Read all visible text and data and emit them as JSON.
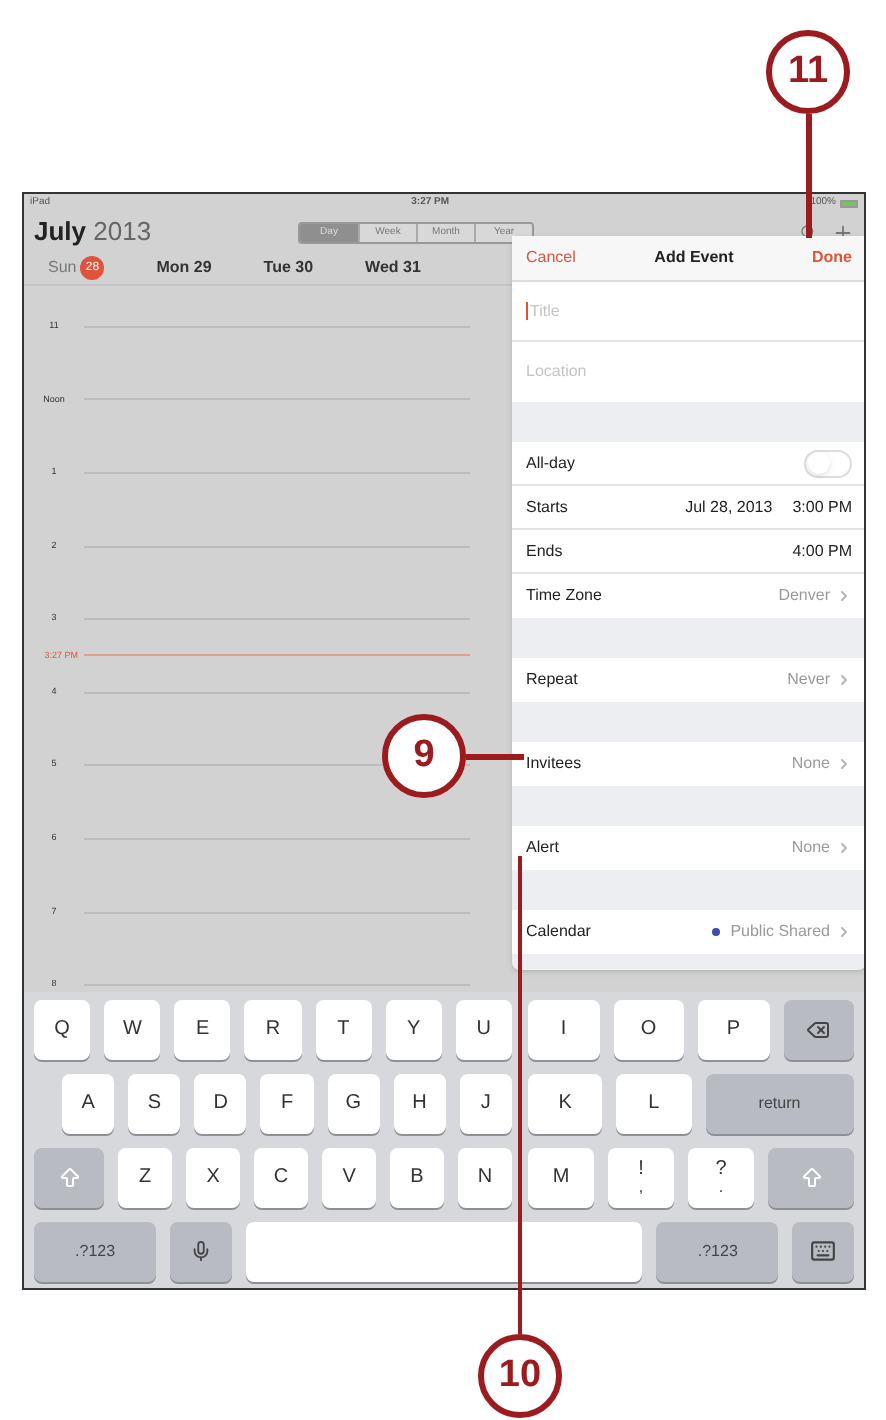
{
  "status_bar": {
    "carrier": "iPad",
    "time": "3:27 PM",
    "battery": "100%"
  },
  "header": {
    "month": "July",
    "year": "2013"
  },
  "view_tabs": [
    {
      "label": "Day",
      "selected": true
    },
    {
      "label": "Week",
      "selected": false
    },
    {
      "label": "Month",
      "selected": false
    },
    {
      "label": "Year",
      "selected": false
    }
  ],
  "days": [
    {
      "label": "Sun",
      "badge": "28",
      "today": true
    },
    {
      "label": "Mon 29",
      "today": false
    },
    {
      "label": "Tue 30",
      "today": false
    },
    {
      "label": "Wed 31",
      "today": false
    }
  ],
  "timeline": [
    {
      "kind": "hour",
      "label": "11"
    },
    {
      "kind": "hour",
      "label": "Noon"
    },
    {
      "kind": "hour",
      "label": "1"
    },
    {
      "kind": "hour",
      "label": "2"
    },
    {
      "kind": "hour",
      "label": "3"
    },
    {
      "kind": "now",
      "label": "3:27 PM"
    },
    {
      "kind": "hour",
      "label": "4"
    },
    {
      "kind": "hour",
      "label": "5"
    },
    {
      "kind": "hour",
      "label": "6"
    },
    {
      "kind": "hour",
      "label": "7"
    },
    {
      "kind": "hour",
      "label": "8"
    }
  ],
  "add_event": {
    "cancel": "Cancel",
    "title": "Add Event",
    "done": "Done",
    "groups": [
      [
        {
          "kind": "input",
          "placeholder": "Title",
          "focused": true
        },
        {
          "kind": "input",
          "placeholder": "Location",
          "focused": false
        }
      ],
      [
        {
          "kind": "toggle",
          "label": "All-day",
          "on": false
        },
        {
          "kind": "value",
          "label": "Starts",
          "date": "Jul 28, 2013",
          "time": "3:00 PM"
        },
        {
          "kind": "value",
          "label": "Ends",
          "time": "4:00 PM"
        },
        {
          "kind": "detail",
          "label": "Time Zone",
          "value": "Denver"
        }
      ],
      [
        {
          "kind": "detail",
          "label": "Repeat",
          "value": "Never"
        }
      ],
      [
        {
          "kind": "detail",
          "label": "Invitees",
          "value": "None"
        }
      ],
      [
        {
          "kind": "detail",
          "label": "Alert",
          "value": "None"
        }
      ],
      [
        {
          "kind": "detail",
          "label": "Calendar",
          "value": "Public Shared",
          "color": "#3b4bb0"
        }
      ]
    ]
  },
  "keyboard": [
    [
      {
        "kind": "char",
        "label": "Q"
      },
      {
        "kind": "char",
        "label": "W"
      },
      {
        "kind": "char",
        "label": "E"
      },
      {
        "kind": "char",
        "label": "R"
      },
      {
        "kind": "char",
        "label": "T"
      },
      {
        "kind": "char",
        "label": "Y"
      },
      {
        "kind": "char",
        "label": "U"
      },
      {
        "kind": "char",
        "label": "I"
      },
      {
        "kind": "char",
        "label": "O"
      },
      {
        "kind": "char",
        "label": "P"
      },
      {
        "kind": "delete"
      }
    ],
    [
      {
        "kind": "char",
        "label": "A"
      },
      {
        "kind": "char",
        "label": "S"
      },
      {
        "kind": "char",
        "label": "D"
      },
      {
        "kind": "char",
        "label": "F"
      },
      {
        "kind": "char",
        "label": "G"
      },
      {
        "kind": "char",
        "label": "H"
      },
      {
        "kind": "char",
        "label": "J"
      },
      {
        "kind": "char",
        "label": "K"
      },
      {
        "kind": "char",
        "label": "L"
      },
      {
        "kind": "return",
        "label": "return"
      }
    ],
    [
      {
        "kind": "shift"
      },
      {
        "kind": "char",
        "label": "Z"
      },
      {
        "kind": "char",
        "label": "X"
      },
      {
        "kind": "char",
        "label": "C"
      },
      {
        "kind": "char",
        "label": "V"
      },
      {
        "kind": "char",
        "label": "B"
      },
      {
        "kind": "char",
        "label": "N"
      },
      {
        "kind": "char",
        "label": "M"
      },
      {
        "kind": "char",
        "label": "!",
        "sub": ","
      },
      {
        "kind": "char",
        "label": "?",
        "sub": "."
      },
      {
        "kind": "shift"
      }
    ],
    [
      {
        "kind": "numbers",
        "label": ".?123"
      },
      {
        "kind": "mic"
      },
      {
        "kind": "space"
      },
      {
        "kind": "numbers",
        "label": ".?123"
      },
      {
        "kind": "hide"
      }
    ]
  ],
  "callouts": [
    {
      "number": "11"
    },
    {
      "number": "9"
    },
    {
      "number": "10"
    }
  ]
}
